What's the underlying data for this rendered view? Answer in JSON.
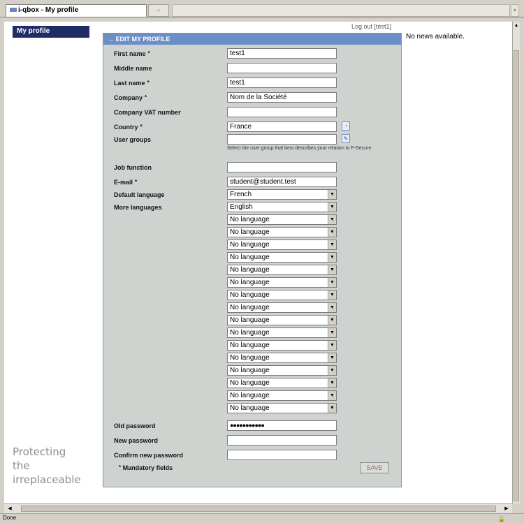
{
  "browser": {
    "tab_title": "i-qbox - My profile",
    "new_tab_icon": "plus-icon",
    "status_text": "Done",
    "status_icon": "lock-icon"
  },
  "sidebar": {
    "my_profile_label": "My profile",
    "tagline": [
      "Protecting",
      "the",
      "irreplaceable"
    ]
  },
  "header": {
    "logout_text": "Log out [test1]"
  },
  "news": {
    "text": "No news available."
  },
  "form": {
    "title": "EDIT MY PROFILE",
    "title_arrow": "→",
    "required_marker": "*",
    "fields": {
      "first_name": {
        "label": "First name",
        "value": "test1",
        "required": true
      },
      "middle_name": {
        "label": "Middle name",
        "value": "",
        "required": false
      },
      "last_name": {
        "label": "Last name",
        "value": "test1",
        "required": true
      },
      "company": {
        "label": "Company",
        "value": "Nom de la Société",
        "required": true
      },
      "company_vat": {
        "label": "Company VAT number",
        "value": "",
        "required": false
      },
      "country": {
        "label": "Country",
        "value": "France",
        "required": true
      },
      "user_groups": {
        "label": "User groups",
        "value": "",
        "helper": "Select the user group that best describes your relation to F-Secure."
      },
      "job_function": {
        "label": "Job function",
        "value": ""
      },
      "email": {
        "label": "E-mail",
        "value": "student@student.test",
        "required": true
      },
      "default_language": {
        "label": "Default language",
        "value": "French"
      },
      "more_languages": {
        "label": "More languages",
        "values": [
          "English",
          "No language",
          "No language",
          "No language",
          "No language",
          "No language",
          "No language",
          "No language",
          "No language",
          "No language",
          "No language",
          "No language",
          "No language",
          "No language",
          "No language",
          "No language",
          "No language"
        ]
      },
      "old_password": {
        "label": "Old password",
        "value": "●●●●●●●●●●●"
      },
      "new_password": {
        "label": "New password",
        "value": ""
      },
      "confirm_password": {
        "label": "Confirm new password",
        "value": ""
      }
    },
    "mandatory_note": "Mandatory fields",
    "save_label": "SAVE"
  },
  "colors": {
    "sidebar_active": "#1f2c66",
    "panel_bg": "#cfd3d0",
    "panel_header": "#6b8ec6"
  }
}
